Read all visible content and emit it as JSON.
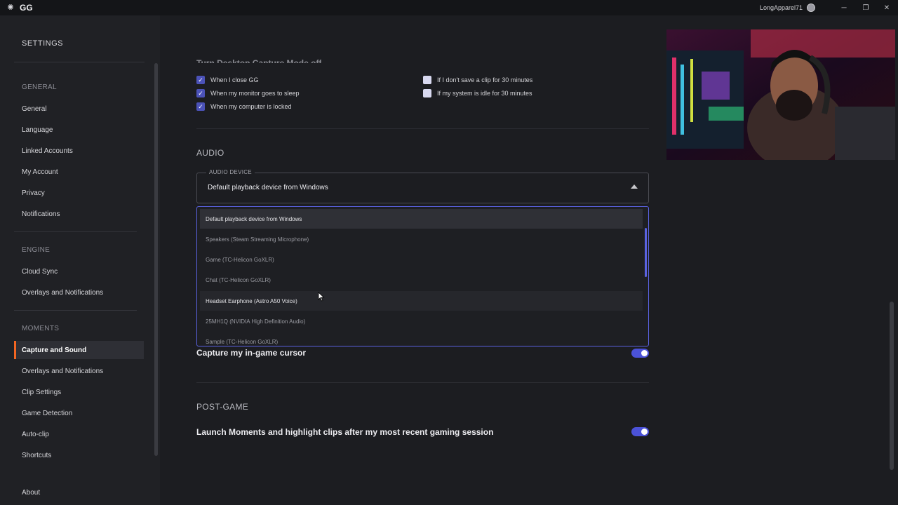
{
  "titlebar": {
    "app": "GG",
    "username": "LongApparel71"
  },
  "sidebar": {
    "title": "SETTINGS",
    "sections": [
      {
        "label": "GENERAL",
        "items": [
          "General",
          "Language",
          "Linked Accounts",
          "My Account",
          "Privacy",
          "Notifications"
        ]
      },
      {
        "label": "ENGINE",
        "items": [
          "Cloud Sync",
          "Overlays and Notifications"
        ]
      },
      {
        "label": "MOMENTS",
        "items": [
          "Capture and Sound",
          "Overlays and Notifications",
          "Clip Settings",
          "Game Detection",
          "Auto-clip",
          "Shortcuts"
        ]
      }
    ],
    "active_item": "Capture and Sound",
    "about": "About"
  },
  "desktop_capture": {
    "heading": "Turn Desktop Capture Mode off",
    "left_options": [
      {
        "label": "When I close GG",
        "checked": true
      },
      {
        "label": "When my monitor goes to sleep",
        "checked": true
      },
      {
        "label": "When my computer is locked",
        "checked": true
      }
    ],
    "right_options": [
      {
        "label": "If I don't save a clip for 30 minutes",
        "checked": false
      },
      {
        "label": "If my system is idle for 30 minutes",
        "checked": false
      }
    ]
  },
  "audio": {
    "heading": "AUDIO",
    "device_label": "AUDIO DEVICE",
    "device_value": "Default playback device from Windows",
    "options": [
      "Default playback device from Windows",
      "Speakers (Steam Streaming Microphone)",
      "Game (TC-Helicon GoXLR)",
      "Chat (TC-Helicon GoXLR)",
      "Headset Earphone (Astro A50 Voice)",
      "25MH1Q (NVIDIA High Definition Audio)",
      "Sample (TC-Helicon GoXLR)"
    ],
    "selected_option": "Default playback device from Windows",
    "hovered_option": "Headset Earphone (Astro A50 Voice)"
  },
  "capture_cursor": {
    "label": "Capture my in-game cursor",
    "enabled": true
  },
  "post_game": {
    "heading": "POST-GAME",
    "label": "Launch Moments and highlight clips after my most recent gaming session",
    "enabled": true
  },
  "colors": {
    "accent": "#4b52d8",
    "active_marker": "#f26522",
    "dropdown_border": "#5a62e0"
  }
}
